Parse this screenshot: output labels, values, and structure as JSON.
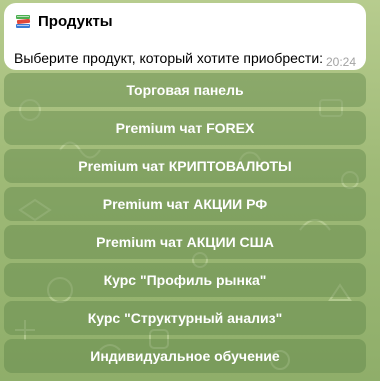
{
  "message": {
    "icon": "books-icon",
    "title": "Продукты",
    "text": "Выберите продукт, который хотите приобрести:",
    "time": "20:24"
  },
  "keyboard": {
    "buttons": [
      {
        "label": "Торговая панель"
      },
      {
        "label": "Premium чат FOREX"
      },
      {
        "label": "Premium чат КРИПТОВАЛЮТЫ"
      },
      {
        "label": "Premium чат АКЦИИ РФ"
      },
      {
        "label": "Premium чат АКЦИИ США"
      },
      {
        "label": "Курс \"Профиль рынка\""
      },
      {
        "label": "Курс \"Структурный анализ\""
      },
      {
        "label": "Индивидуальное обучение"
      }
    ]
  },
  "colors": {
    "background": "#a8c280",
    "button_bg": "#6f9458",
    "bubble": "#ffffff",
    "time": "#a3a3a3"
  }
}
